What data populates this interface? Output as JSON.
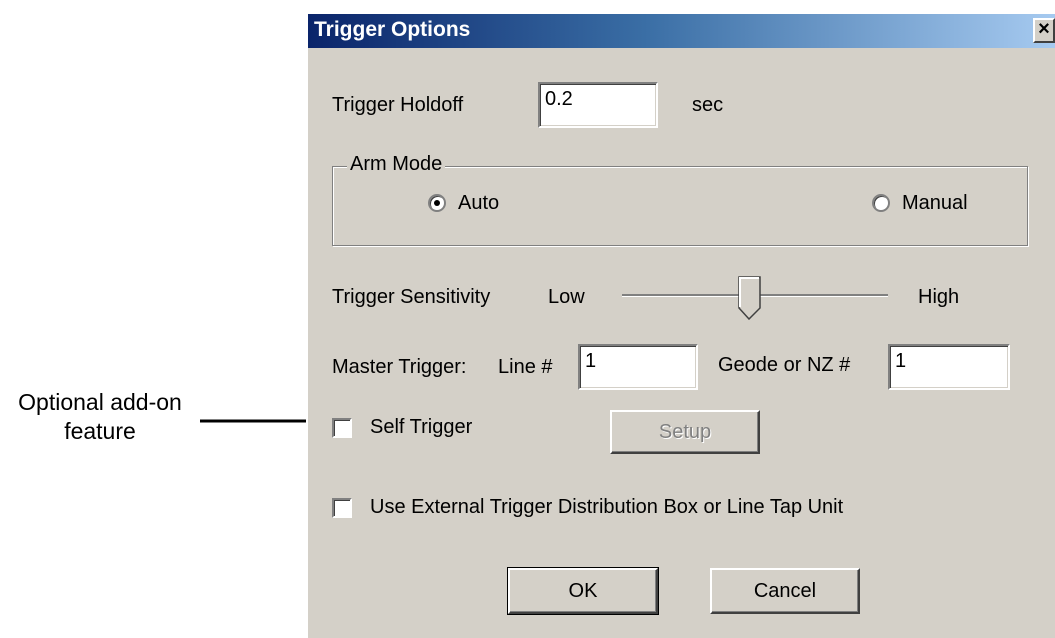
{
  "annotation": {
    "line1": "Optional add-on",
    "line2": "feature"
  },
  "dialog": {
    "title": "Trigger Options",
    "close_symbol": "×",
    "holdoff": {
      "label": "Trigger Holdoff",
      "value": "0.2",
      "unit": "sec"
    },
    "arm_mode": {
      "legend": "Arm Mode",
      "options": [
        {
          "label": "Auto",
          "selected": true
        },
        {
          "label": "Manual",
          "selected": false
        }
      ]
    },
    "sensitivity": {
      "label": "Trigger Sensitivity",
      "low": "Low",
      "high": "High",
      "level": 0.5
    },
    "master_trigger": {
      "label": "Master Trigger:",
      "line_label": "Line #",
      "line_value": "1",
      "geode_label": "Geode or NZ #",
      "geode_value": "1"
    },
    "self_trigger": {
      "label": "Self Trigger",
      "checked": false,
      "setup_label": "Setup"
    },
    "external_box": {
      "label": "Use External Trigger Distribution Box or Line Tap Unit",
      "checked": false
    },
    "ok_label": "OK",
    "cancel_label": "Cancel"
  }
}
